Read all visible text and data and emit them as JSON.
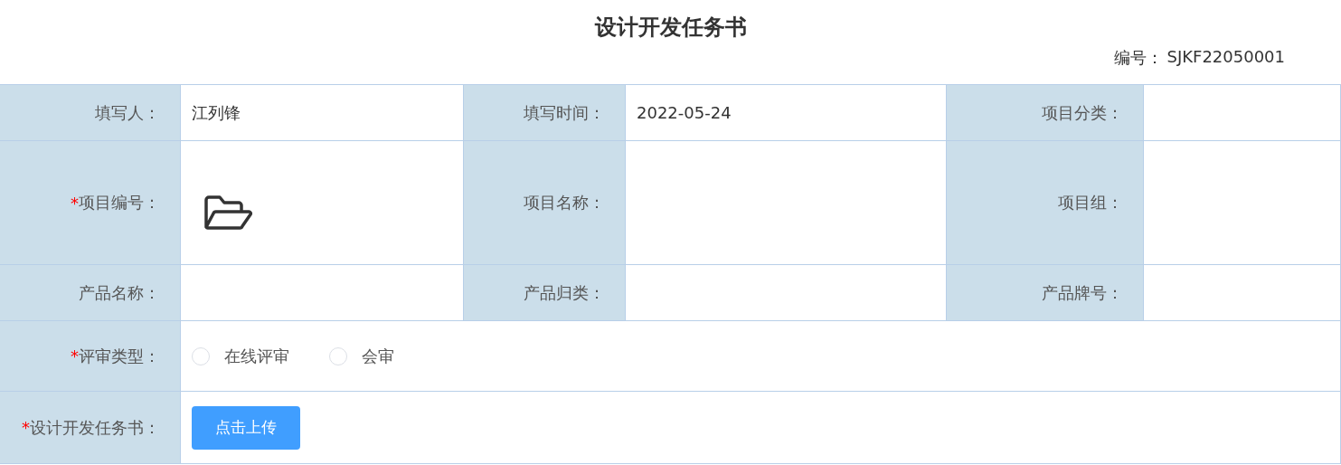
{
  "title": "设计开发任务书",
  "number": {
    "label": "编号：",
    "value": "SJKF22050001"
  },
  "rows": [
    {
      "kind": "fields",
      "fields": [
        {
          "label": "填写人：",
          "value": "江列锋"
        },
        {
          "label": "填写时间：",
          "value": "2022-05-24"
        },
        {
          "label": "项目分类："
        }
      ]
    },
    {
      "kind": "fields",
      "fields": [
        {
          "required_mark": "*",
          "label": "项目编号：",
          "browse": true
        },
        {
          "label": "项目名称："
        },
        {
          "label": "项目组："
        }
      ]
    },
    {
      "kind": "fields",
      "fields": [
        {
          "label": "产品名称："
        },
        {
          "label": "产品归类："
        },
        {
          "label": "产品牌号："
        }
      ]
    },
    {
      "kind": "radios",
      "required_mark": "*",
      "label": "评审类型：",
      "options": [
        {
          "label": "在线评审",
          "selected": false
        },
        {
          "label": "会审",
          "selected": false
        }
      ]
    },
    {
      "kind": "upload",
      "required_mark": "*",
      "label": "设计开发任务书：",
      "button": "点击上传"
    }
  ]
}
